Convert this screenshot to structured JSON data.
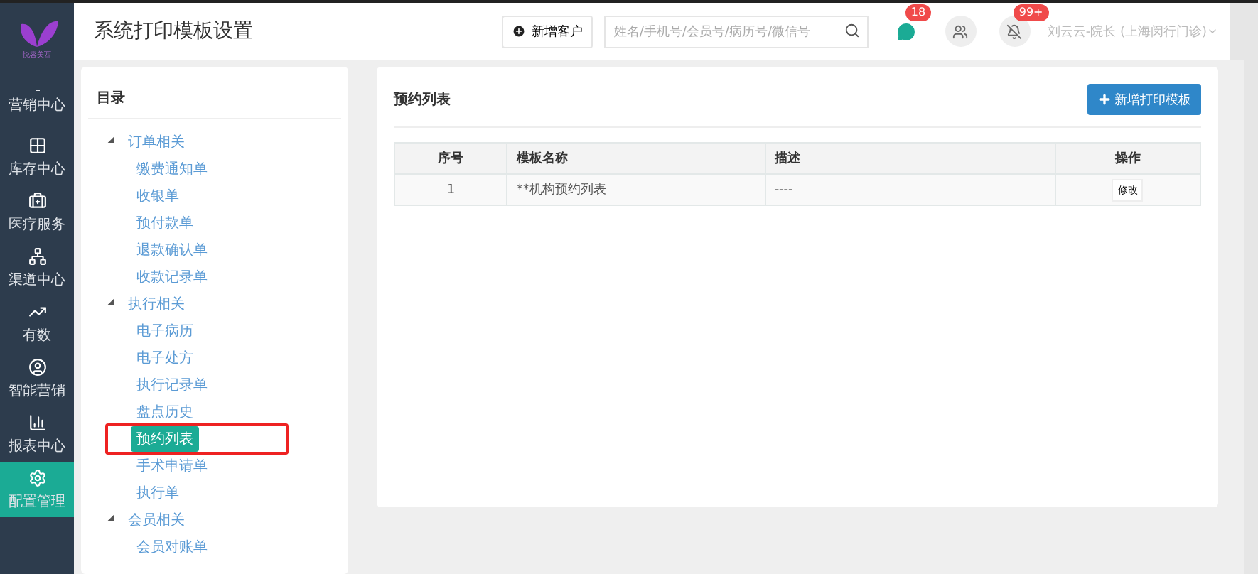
{
  "sidebar": {
    "logo_text": "悦容美西",
    "items": [
      {
        "label": "营销中心",
        "selected": false
      },
      {
        "label": "库存中心",
        "selected": false
      },
      {
        "label": "医疗服务",
        "selected": false
      },
      {
        "label": "渠道中心",
        "selected": false
      },
      {
        "label": "有数",
        "selected": false
      },
      {
        "label": "智能营销",
        "selected": false
      },
      {
        "label": "报表中心",
        "selected": false
      },
      {
        "label": "配置管理",
        "selected": true
      }
    ]
  },
  "header": {
    "title": "系统打印模板设置",
    "add_customer": "新增客户",
    "search": {
      "placeholder": "姓名/手机号/会员号/病历号/微信号"
    },
    "message_badge": "18",
    "alert_badge": "99+",
    "user": "刘云云-院长 (上海闵行门诊)"
  },
  "catalog": {
    "title": "目录",
    "groups": [
      {
        "label": "订单相关",
        "expanded": true,
        "children": [
          {
            "label": "缴费通知单",
            "selected": false
          },
          {
            "label": "收银单",
            "selected": false
          },
          {
            "label": "预付款单",
            "selected": false
          },
          {
            "label": "退款确认单",
            "selected": false
          },
          {
            "label": "收款记录单",
            "selected": false
          }
        ]
      },
      {
        "label": "执行相关",
        "expanded": true,
        "children": [
          {
            "label": "电子病历",
            "selected": false
          },
          {
            "label": "电子处方",
            "selected": false
          },
          {
            "label": "执行记录单",
            "selected": false
          },
          {
            "label": "盘点历史",
            "selected": false
          },
          {
            "label": "预约列表",
            "selected": true
          },
          {
            "label": "手术申请单",
            "selected": false
          },
          {
            "label": "执行单",
            "selected": false
          }
        ]
      },
      {
        "label": "会员相关",
        "expanded": true,
        "children": [
          {
            "label": "会员对账单",
            "selected": false
          }
        ]
      }
    ]
  },
  "panel": {
    "title": "预约列表",
    "add_button": "新增打印模板",
    "table": {
      "columns": [
        "序号",
        "模板名称",
        "描述",
        "操作"
      ],
      "rows": [
        {
          "index": "1",
          "name": "**机构预约列表",
          "description": "----",
          "action": "修改"
        }
      ]
    }
  }
}
